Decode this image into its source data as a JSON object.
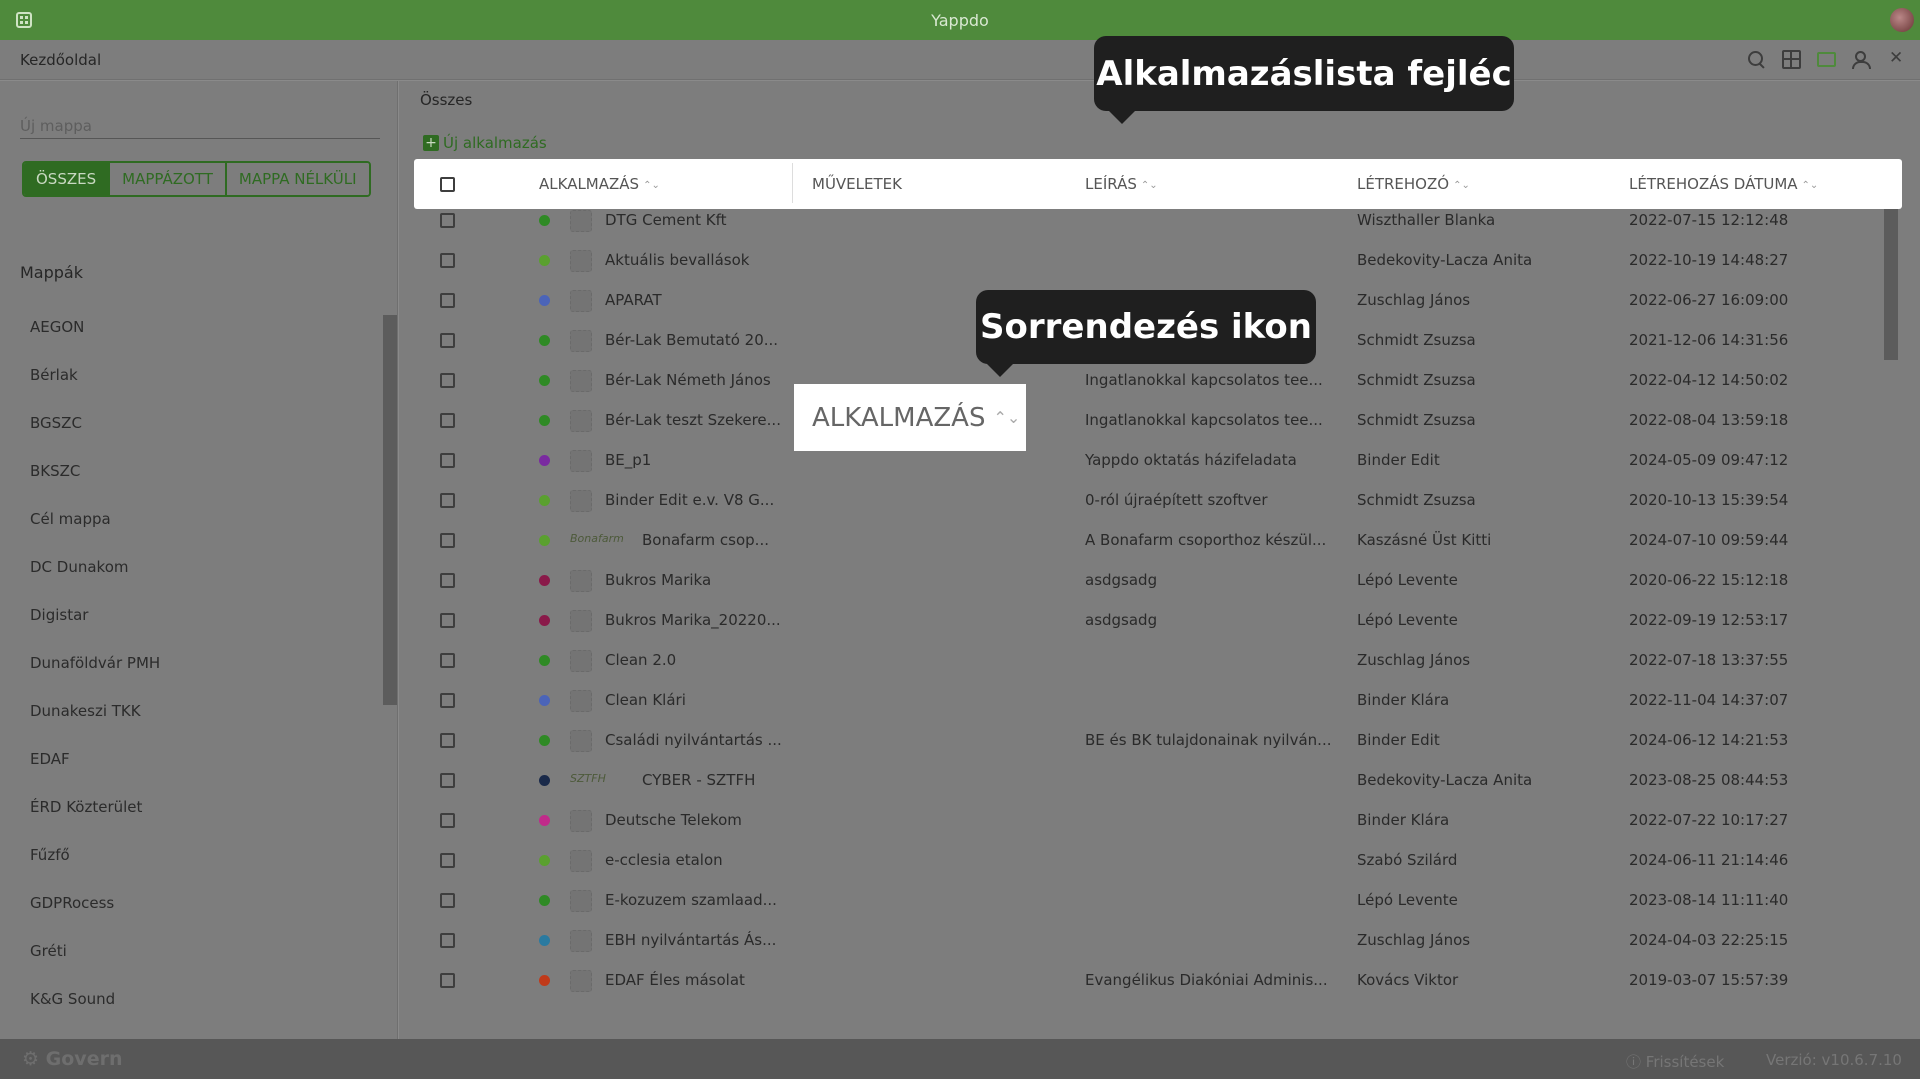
{
  "window": {
    "title": "Yappdo"
  },
  "topnav": {
    "home": "Kezdőoldal"
  },
  "sidebar": {
    "new_folder_placeholder": "Új mappa",
    "filters": [
      "ÖSSZES",
      "MAPPÁZOTT",
      "MAPPA NÉLKÜLI"
    ],
    "active_filter": "ÖSSZES",
    "folders_title": "Mappák",
    "folders": [
      "AEGON",
      "Bérlak",
      "BGSZC",
      "BKSZC",
      "Cél mappa",
      "DC Dunakom",
      "Digistar",
      "Dunaföldvár PMH",
      "Dunakeszi TKK",
      "EDAF",
      "ÉRD Közterület",
      "Fűzfő",
      "GDPRocess",
      "Gréti",
      "K&G Sound"
    ]
  },
  "main": {
    "breadcrumb": "Összes",
    "new_app_label": "Új alkalmazás",
    "columns": {
      "app": "ALKALMAZÁS",
      "actions": "MŰVELETEK",
      "description": "LEÍRÁS",
      "creator": "LÉTREHOZÓ",
      "created": "LÉTREHOZÁS DÁTUMA"
    },
    "rows": [
      {
        "name": "DTG Cement Kft",
        "desc": "",
        "creator": "Wiszthaller Blanka",
        "date": "2022-07-15 12:12:48",
        "dot": "#2f8a25"
      },
      {
        "name": "Aktuális bevallások",
        "desc": "",
        "creator": "Bedekovity-Lacza Anita",
        "date": "2022-10-19 14:48:27",
        "dot": "#5aa02f"
      },
      {
        "name": "APARAT",
        "desc": "",
        "creator": "Zuschlag János",
        "date": "2022-06-27 16:09:00",
        "dot": "#4b64b8"
      },
      {
        "name": "Bér-Lak Bemutató 20...",
        "desc": "",
        "creator": "Schmidt Zsuzsa",
        "date": "2021-12-06 14:31:56",
        "dot": "#2f8a25"
      },
      {
        "name": "Bér-Lak Németh János",
        "desc": "Ingatlanokkal kapcsolatos tee...",
        "creator": "Schmidt Zsuzsa",
        "date": "2022-04-12 14:50:02",
        "dot": "#2f8a25"
      },
      {
        "name": "Bér-Lak teszt Szekere...",
        "desc": "Ingatlanokkal kapcsolatos tee...",
        "creator": "Schmidt Zsuzsa",
        "date": "2022-08-04 13:59:18",
        "dot": "#2f8a25"
      },
      {
        "name": "BE_p1",
        "desc": "Yappdo oktatás házifeladata",
        "creator": "Binder Edit",
        "date": "2024-05-09 09:47:12",
        "dot": "#7a2aa0"
      },
      {
        "name": "Binder Edit e.v. V8 G...",
        "desc": "0-ról újraépített szoftver",
        "creator": "Schmidt Zsuzsa",
        "date": "2020-10-13 15:39:54",
        "dot": "#5aa02f"
      },
      {
        "name": "Bonafarm csop...",
        "desc": "A Bonafarm csoporthoz készül...",
        "creator": "Kaszásné Üst Kitti",
        "date": "2024-07-10 09:59:44",
        "dot": "#5aa02f",
        "logo": "Bonafarm"
      },
      {
        "name": "Bukros Marika",
        "desc": "asdgsadg",
        "creator": "Lépó Levente",
        "date": "2020-06-22 15:12:18",
        "dot": "#8a1a4a"
      },
      {
        "name": "Bukros Marika_20220...",
        "desc": "asdgsadg",
        "creator": "Lépó Levente",
        "date": "2022-09-19 12:53:17",
        "dot": "#8a1a4a"
      },
      {
        "name": "Clean 2.0",
        "desc": "",
        "creator": "Zuschlag János",
        "date": "2022-07-18 13:37:55",
        "dot": "#2f8a25"
      },
      {
        "name": "Clean Klári",
        "desc": "",
        "creator": "Binder Klára",
        "date": "2022-11-04 14:37:07",
        "dot": "#4b64b8"
      },
      {
        "name": "Családi nyilvántartás ...",
        "desc": "BE és BK tulajdonainak nyilván...",
        "creator": "Binder Edit",
        "date": "2024-06-12 14:21:53",
        "dot": "#2f8a25"
      },
      {
        "name": "CYBER - SZTFH",
        "desc": "",
        "creator": "Bedekovity-Lacza Anita",
        "date": "2023-08-25 08:44:53",
        "dot": "#1a2a4a",
        "logo": "SZTFH"
      },
      {
        "name": "Deutsche Telekom",
        "desc": "",
        "creator": "Binder Klára",
        "date": "2022-07-22 10:17:27",
        "dot": "#c02a8a"
      },
      {
        "name": "e-cclesia etalon",
        "desc": "",
        "creator": "Szabó Szilárd",
        "date": "2024-06-11 21:14:46",
        "dot": "#5aa02f"
      },
      {
        "name": "E-kozuzem szamlaad...",
        "desc": "",
        "creator": "Lépó Levente",
        "date": "2023-08-14 11:11:40",
        "dot": "#2f8a25"
      },
      {
        "name": "EBH nyilvántartás Ás...",
        "desc": "",
        "creator": "Zuschlag János",
        "date": "2024-04-03 22:25:15",
        "dot": "#2a7aa0"
      },
      {
        "name": "EDAF Éles másolat",
        "desc": "Evangélikus Diakóniai Adminis...",
        "creator": "Kovács Viktor",
        "date": "2019-03-07 15:57:39",
        "dot": "#c03a1a"
      }
    ]
  },
  "callouts": {
    "header": "Alkalmazáslista fejléc",
    "sort": "Sorrendezés ikon"
  },
  "zoom": {
    "label": "ALKALMAZÁS"
  },
  "footer": {
    "brand": "Govern",
    "updates": "Frissítések",
    "version": "Verzió: v10.6.7.10"
  }
}
